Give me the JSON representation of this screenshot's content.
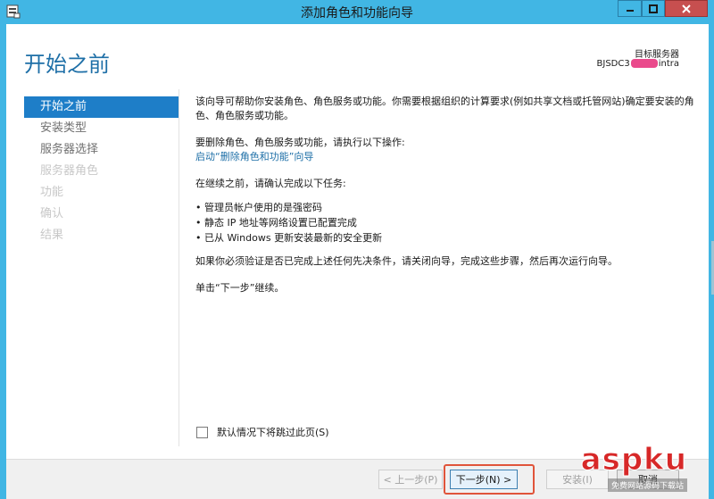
{
  "window": {
    "title": "添加角色和功能向导"
  },
  "header": {
    "page_title": "开始之前",
    "server_label": "目标服务器",
    "server_name_prefix": "BJSDC3",
    "server_name_suffix": "intra"
  },
  "nav": {
    "items": [
      {
        "label": "开始之前",
        "state": "active"
      },
      {
        "label": "安装类型",
        "state": "enabled"
      },
      {
        "label": "服务器选择",
        "state": "enabled"
      },
      {
        "label": "服务器角色",
        "state": "disabled"
      },
      {
        "label": "功能",
        "state": "disabled"
      },
      {
        "label": "确认",
        "state": "disabled"
      },
      {
        "label": "结果",
        "state": "disabled"
      }
    ]
  },
  "content": {
    "intro": "该向导可帮助你安装角色、角色服务或功能。你需要根据组织的计算要求(例如共享文档或托管网站)确定要安装的角色、角色服务或功能。",
    "remove_instruction": "要删除角色、角色服务或功能，请执行以下操作:",
    "remove_link": "启动“删除角色和功能”向导",
    "before_continue": "在继续之前，请确认完成以下任务:",
    "tasks": [
      "管理员帐户使用的是强密码",
      "静态 IP 地址等网络设置已配置完成",
      "已从 Windows 更新安装最新的安全更新"
    ],
    "verify_note": "如果你必须验证是否已完成上述任何先决条件，请关闭向导，完成这些步骤，然后再次运行向导。",
    "click_next": "单击“下一步”继续。",
    "skip_label": "默认情况下将跳过此页(S)"
  },
  "footer": {
    "prev_label": "< 上一步(P)",
    "next_label": "下一步(N) >",
    "install_label": "安装(I)",
    "cancel_label": "取消"
  },
  "watermark": {
    "main": "aspku",
    "sub": "免费网站源码下载站"
  },
  "colors": {
    "titlebar": "#41b6e4",
    "accent": "#1e7ec8",
    "title_blue": "#1e6fa7",
    "close_red": "#c74f4f",
    "highlight": "#e0543a"
  }
}
